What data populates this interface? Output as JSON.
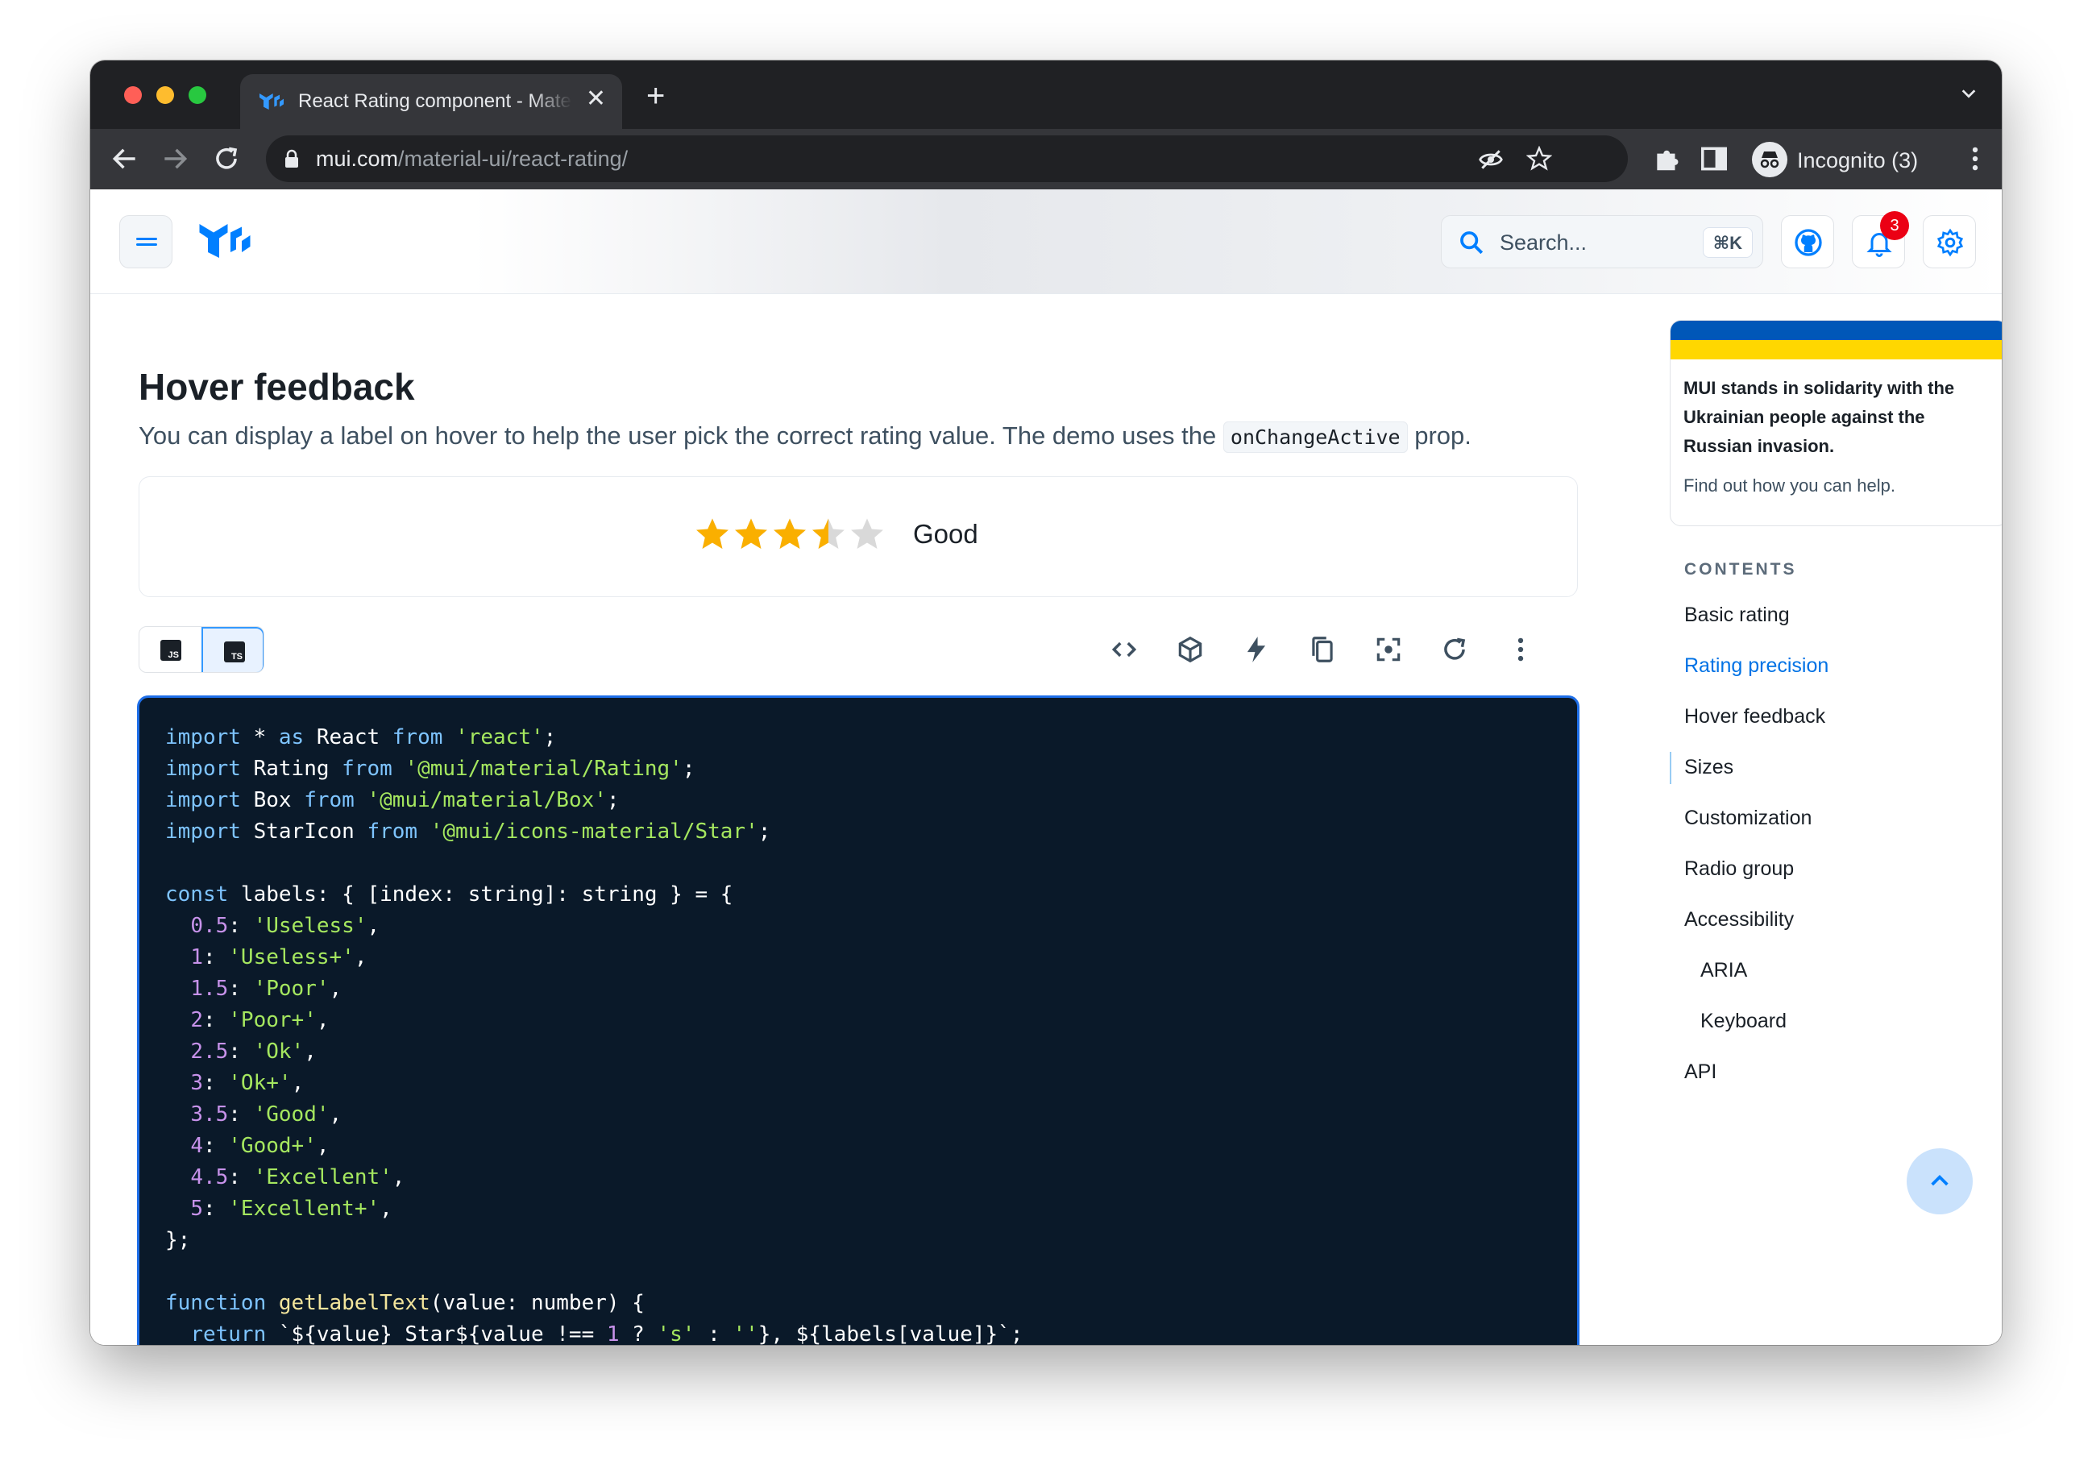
{
  "browser": {
    "tab_title": "React Rating component - Material UI",
    "tab_close": "✕",
    "new_tab": "+",
    "url_host": "mui.com",
    "url_path": "/material-ui/react-rating/",
    "profile_label": "Incognito (3)"
  },
  "header": {
    "search_placeholder": "Search...",
    "search_shortcut": "⌘K",
    "notifications_count": "3"
  },
  "section": {
    "title": "Hover feedback",
    "description_before": "You can display a label on hover to help the user pick the correct rating value. The demo uses the ",
    "description_code": "onChangeActive",
    "description_after": " prop."
  },
  "demo": {
    "rating_value": 3.5,
    "rating_max": 5,
    "hover_label": "Good",
    "colors": {
      "star_filled": "#faaf00",
      "star_empty": "#d9d9d9"
    }
  },
  "code_toolbar": {
    "js_label": "JS",
    "ts_label": "TS",
    "tools": [
      "code-icon",
      "codesandbox-icon",
      "stackblitz-icon",
      "copy-icon",
      "reset-focus-icon",
      "reset-icon",
      "more-icon"
    ]
  },
  "code": {
    "lines": [
      [
        [
          "kw",
          "import"
        ],
        [
          "t",
          " * "
        ],
        [
          "kw",
          "as"
        ],
        [
          "t",
          " React "
        ],
        [
          "kw",
          "from"
        ],
        [
          "t",
          " "
        ],
        [
          "str",
          "'react'"
        ],
        [
          "t",
          ";"
        ]
      ],
      [
        [
          "kw",
          "import"
        ],
        [
          "t",
          " Rating "
        ],
        [
          "kw",
          "from"
        ],
        [
          "t",
          " "
        ],
        [
          "str",
          "'@mui/material/Rating'"
        ],
        [
          "t",
          ";"
        ]
      ],
      [
        [
          "kw",
          "import"
        ],
        [
          "t",
          " Box "
        ],
        [
          "kw",
          "from"
        ],
        [
          "t",
          " "
        ],
        [
          "str",
          "'@mui/material/Box'"
        ],
        [
          "t",
          ";"
        ]
      ],
      [
        [
          "kw",
          "import"
        ],
        [
          "t",
          " StarIcon "
        ],
        [
          "kw",
          "from"
        ],
        [
          "t",
          " "
        ],
        [
          "str",
          "'@mui/icons-material/Star'"
        ],
        [
          "t",
          ";"
        ]
      ],
      [],
      [
        [
          "kw",
          "const"
        ],
        [
          "t",
          " labels: { [index: string]: string } = {"
        ]
      ],
      [
        [
          "t",
          "  "
        ],
        [
          "num",
          "0.5"
        ],
        [
          "t",
          ": "
        ],
        [
          "str",
          "'Useless'"
        ],
        [
          "t",
          ","
        ]
      ],
      [
        [
          "t",
          "  "
        ],
        [
          "num",
          "1"
        ],
        [
          "t",
          ": "
        ],
        [
          "str",
          "'Useless+'"
        ],
        [
          "t",
          ","
        ]
      ],
      [
        [
          "t",
          "  "
        ],
        [
          "num",
          "1.5"
        ],
        [
          "t",
          ": "
        ],
        [
          "str",
          "'Poor'"
        ],
        [
          "t",
          ","
        ]
      ],
      [
        [
          "t",
          "  "
        ],
        [
          "num",
          "2"
        ],
        [
          "t",
          ": "
        ],
        [
          "str",
          "'Poor+'"
        ],
        [
          "t",
          ","
        ]
      ],
      [
        [
          "t",
          "  "
        ],
        [
          "num",
          "2.5"
        ],
        [
          "t",
          ": "
        ],
        [
          "str",
          "'Ok'"
        ],
        [
          "t",
          ","
        ]
      ],
      [
        [
          "t",
          "  "
        ],
        [
          "num",
          "3"
        ],
        [
          "t",
          ": "
        ],
        [
          "str",
          "'Ok+'"
        ],
        [
          "t",
          ","
        ]
      ],
      [
        [
          "t",
          "  "
        ],
        [
          "num",
          "3.5"
        ],
        [
          "t",
          ": "
        ],
        [
          "str",
          "'Good'"
        ],
        [
          "t",
          ","
        ]
      ],
      [
        [
          "t",
          "  "
        ],
        [
          "num",
          "4"
        ],
        [
          "t",
          ": "
        ],
        [
          "str",
          "'Good+'"
        ],
        [
          "t",
          ","
        ]
      ],
      [
        [
          "t",
          "  "
        ],
        [
          "num",
          "4.5"
        ],
        [
          "t",
          ": "
        ],
        [
          "str",
          "'Excellent'"
        ],
        [
          "t",
          ","
        ]
      ],
      [
        [
          "t",
          "  "
        ],
        [
          "num",
          "5"
        ],
        [
          "t",
          ": "
        ],
        [
          "str",
          "'Excellent+'"
        ],
        [
          "t",
          ","
        ]
      ],
      [
        [
          "t",
          "};"
        ]
      ],
      [],
      [
        [
          "kw",
          "function"
        ],
        [
          "t",
          " "
        ],
        [
          "fn",
          "getLabelText"
        ],
        [
          "t",
          "(value: number) {"
        ]
      ],
      [
        [
          "t",
          "  "
        ],
        [
          "kw",
          "return"
        ],
        [
          "t",
          " `${value} Star${value !== "
        ],
        [
          "num",
          "1"
        ],
        [
          "t",
          " ? "
        ],
        [
          "str",
          "'s'"
        ],
        [
          "t",
          " : "
        ],
        [
          "str",
          "''"
        ],
        [
          "t",
          "}, ${labels[value]}`;"
        ]
      ]
    ]
  },
  "sidebar": {
    "banner_message": "MUI stands in solidarity with the Ukrainian people against the Russian invasion.",
    "banner_link": "Find out how you can help.",
    "contents_title": "CONTENTS",
    "items": [
      {
        "label": "Basic rating",
        "level": 0,
        "active": false
      },
      {
        "label": "Rating precision",
        "level": 0,
        "active": true
      },
      {
        "label": "Hover feedback",
        "level": 0,
        "active": false
      },
      {
        "label": "Sizes",
        "level": 0,
        "active": false
      },
      {
        "label": "Customization",
        "level": 0,
        "active": false
      },
      {
        "label": "Radio group",
        "level": 0,
        "active": false
      },
      {
        "label": "Accessibility",
        "level": 0,
        "active": false
      },
      {
        "label": "ARIA",
        "level": 1,
        "active": false
      },
      {
        "label": "Keyboard",
        "level": 1,
        "active": false
      },
      {
        "label": "API",
        "level": 0,
        "active": false
      }
    ]
  }
}
